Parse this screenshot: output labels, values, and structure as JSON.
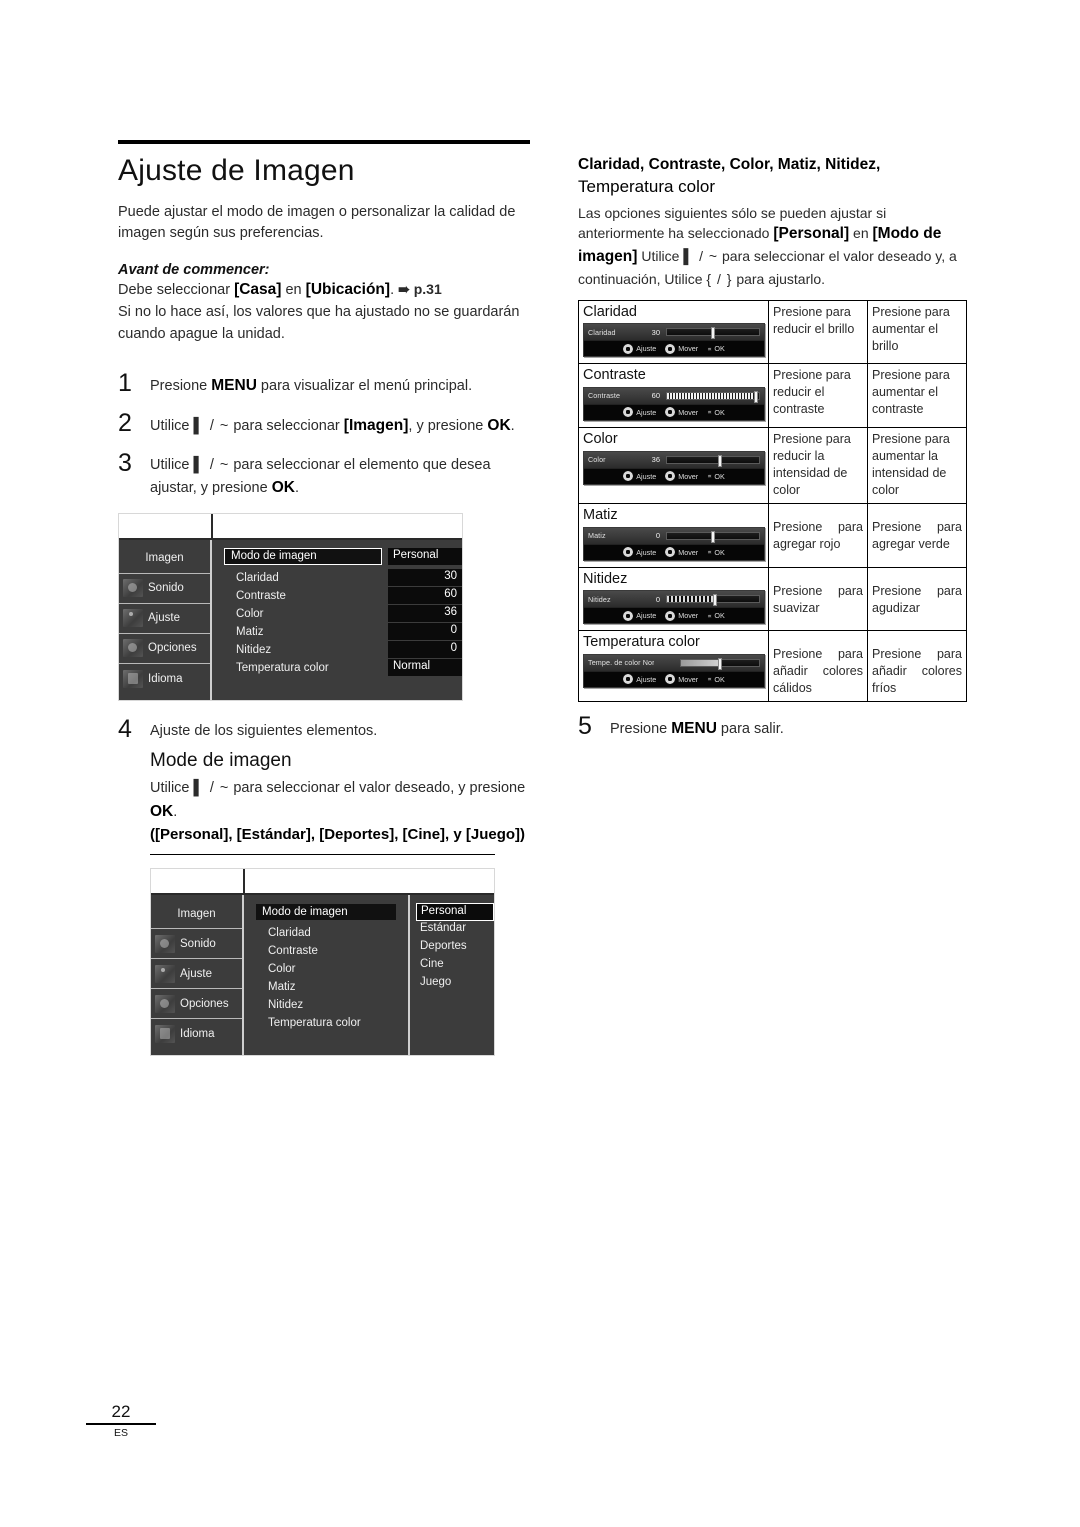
{
  "document": {
    "page_number": "22",
    "page_language_code": "ES"
  },
  "left": {
    "title": "Ajuste de Imagen",
    "lead": "Puede ajustar el modo de imagen o personalizar la calidad de imagen según sus preferencias.",
    "before_label": "Avant de commencer:",
    "before_line1_pre": "Debe seleccionar ",
    "before_line1_b1": "[Casa]",
    "before_line1_mid": " en ",
    "before_line1_b2": "[Ubicación]",
    "before_line1_post": ". ",
    "before_line1_ref": "➠ p.31",
    "before_line2": "Si no lo hace así, los valores que ha ajustado no se guardarán cuando apague la unidad.",
    "steps": [
      {
        "num": "1",
        "pre": "Presione ",
        "key": "MENU",
        "post": " para visualizar el menú principal."
      },
      {
        "num": "2",
        "pre": "Utilice ",
        "arrows": "▌ / ~",
        "mid": " para seleccionar ",
        "key": "[Imagen]",
        "mid2": ", y presione ",
        "key2": "OK",
        "post": "."
      },
      {
        "num": "3",
        "pre": "Utilice ",
        "arrows": "▌ / ~",
        "mid": " para seleccionar el elemento que desea ajustar, y presione ",
        "key2": "OK",
        "post": "."
      },
      {
        "num": "4",
        "text": "Ajuste de los siguientes elementos."
      },
      {
        "num": "5",
        "pre": "Presione ",
        "key": "MENU",
        "post": " para salir."
      }
    ],
    "step4": {
      "subhead": "Mode de imagen",
      "line1_pre": "Utilice ",
      "line1_arrows": "▌ / ~",
      "line1_mid": " para seleccionar el valor deseado, y presione ",
      "line1_key": "OK",
      "line1_post": ".",
      "line2": "([Personal], [Estándar], [Deportes], [Cine], y [Juego])"
    }
  },
  "osd_menu_1": {
    "sidebar": [
      {
        "label": "Imagen",
        "icon": "picture-icon",
        "selected": true
      },
      {
        "label": "Sonido",
        "icon": "sound-icon",
        "selected": false
      },
      {
        "label": "Ajuste",
        "icon": "settings-icon",
        "selected": false
      },
      {
        "label": "Opciones",
        "icon": "options-icon",
        "selected": false
      },
      {
        "label": "Idioma",
        "icon": "language-icon",
        "selected": false
      }
    ],
    "rows": [
      {
        "name": "Modo de imagen",
        "value": "Personal",
        "highlighted": true,
        "value_align": "left"
      },
      {
        "name": "Claridad",
        "value": "30",
        "highlighted": false,
        "value_align": "right"
      },
      {
        "name": "Contraste",
        "value": "60",
        "highlighted": false,
        "value_align": "right"
      },
      {
        "name": "Color",
        "value": "36",
        "highlighted": false,
        "value_align": "right"
      },
      {
        "name": "Matiz",
        "value": "0",
        "highlighted": false,
        "value_align": "right"
      },
      {
        "name": "Nitidez",
        "value": "0",
        "highlighted": false,
        "value_align": "right"
      },
      {
        "name": "Temperatura color",
        "value": "Normal",
        "highlighted": false,
        "value_align": "left"
      }
    ]
  },
  "osd_menu_2": {
    "sidebar": [
      {
        "label": "Imagen",
        "icon": "picture-icon",
        "selected": true
      },
      {
        "label": "Sonido",
        "icon": "sound-icon",
        "selected": false
      },
      {
        "label": "Ajuste",
        "icon": "settings-icon",
        "selected": false
      },
      {
        "label": "Opciones",
        "icon": "options-icon",
        "selected": false
      },
      {
        "label": "Idioma",
        "icon": "language-icon",
        "selected": false
      }
    ],
    "rows": [
      {
        "name": "Modo de imagen",
        "highlighted": true
      },
      {
        "name": "Claridad",
        "highlighted": false
      },
      {
        "name": "Contraste",
        "highlighted": false
      },
      {
        "name": "Color",
        "highlighted": false
      },
      {
        "name": "Matiz",
        "highlighted": false
      },
      {
        "name": "Nitidez",
        "highlighted": false
      },
      {
        "name": "Temperatura color",
        "highlighted": false
      }
    ],
    "options": [
      {
        "label": "Personal",
        "selected": true
      },
      {
        "label": "Estándar",
        "selected": false
      },
      {
        "label": "Deportes",
        "selected": false
      },
      {
        "label": "Cine",
        "selected": false
      },
      {
        "label": "Juego",
        "selected": false
      }
    ]
  },
  "right": {
    "title_bold": "Claridad, Contraste, Color, Matiz, Nitidez,",
    "title_light": "Temperatura color",
    "body_1": "Las opciones siguientes sólo se pueden ajustar si anteriormente ha seleccionado ",
    "body_b1": "[Personal]",
    "body_2": " en ",
    "body_b2": "[Modo de imagen]",
    "body_3": " Utilice ",
    "body_arrows_1": "▌ / ~",
    "body_4": " para seleccionar el valor deseado y, a continuación, Utilice ",
    "body_arrows_2": "{ / }",
    "body_5": " para ajustarlo.",
    "hints": {
      "adjust": "Ajuste",
      "move": "Mover",
      "ok": "OK",
      "ok_prefix": "∝"
    },
    "table": [
      {
        "item": "Claridad",
        "osd_label": "Claridad",
        "osd_value": "30",
        "fill_style": "empty",
        "knob_pct": 48,
        "fill_pct": 0,
        "left_text": "Presione  para reducir el brillo",
        "right_text": "Presione  para aumentar el brillo",
        "justify": false
      },
      {
        "item": "Contraste",
        "osd_label": "Contraste",
        "osd_value": "60",
        "fill_style": "dither",
        "knob_pct": 95,
        "fill_pct": 95,
        "left_text": "Presione  para reducir el contraste",
        "right_text": "Presione  para aumentar el contraste",
        "justify": false
      },
      {
        "item": "Color",
        "osd_label": "Color",
        "osd_value": "36",
        "fill_style": "empty",
        "knob_pct": 55,
        "fill_pct": 0,
        "left_text": "Presione  para reducir la intensidad de color",
        "right_text": "Presione  para aumentar la intensidad de color",
        "justify": false
      },
      {
        "item": "Matiz",
        "osd_label": "Matiz",
        "osd_value": "0",
        "fill_style": "empty",
        "knob_pct": 48,
        "fill_pct": 0,
        "left_text": "Presione para agregar rojo",
        "right_text": "Presione para agregar verde",
        "justify": true
      },
      {
        "item": "Nitidez",
        "osd_label": "Nitidez",
        "osd_value": "0",
        "fill_style": "dots",
        "knob_pct": 50,
        "fill_pct": 50,
        "left_text": "Presione para suavizar",
        "right_text": "Presione para agudizar",
        "justify": true
      },
      {
        "item": "Temperatura color",
        "osd_label": "Tempe. de color Normal",
        "osd_value": "",
        "fill_style": "grad",
        "knob_pct": 48,
        "fill_pct": 48,
        "left_text": "Presione para añadir colores cálidos",
        "right_text": "Presione para añadir colores fríos",
        "justify": true
      }
    ]
  }
}
